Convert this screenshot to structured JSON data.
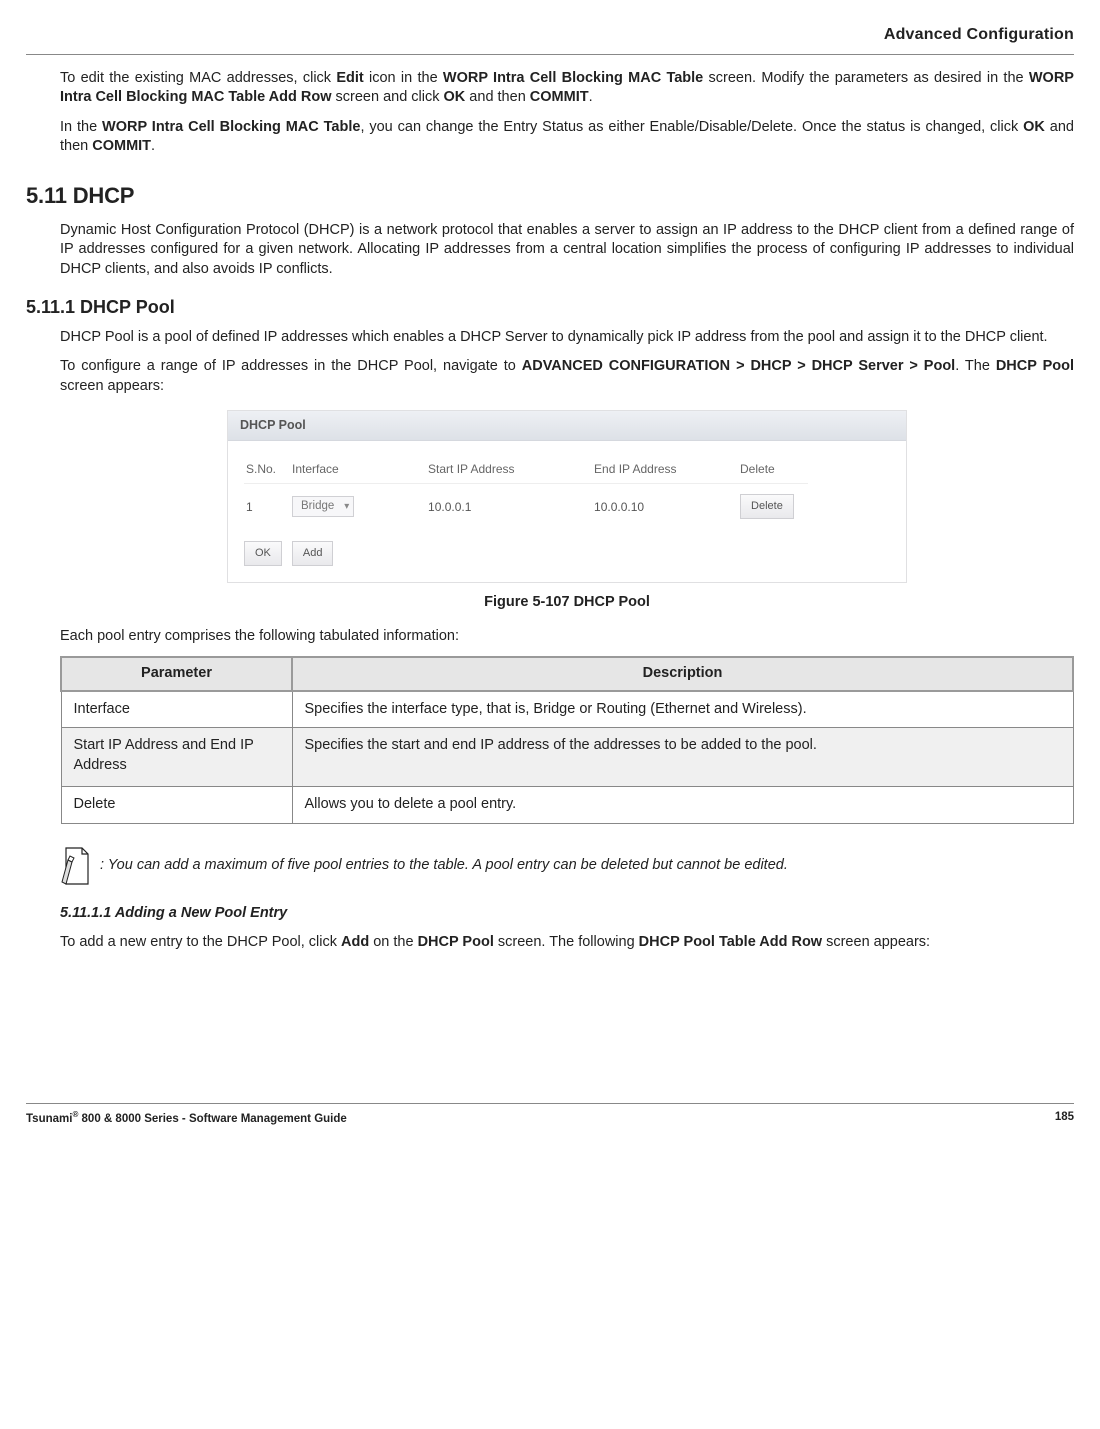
{
  "header": {
    "chapter": "Advanced Configuration"
  },
  "intro": {
    "p1_a": "To edit the existing MAC addresses, click ",
    "p1_b": "Edit",
    "p1_c": " icon in the ",
    "p1_d": "WORP Intra Cell Blocking MAC Table",
    "p1_e": " screen. Modify the parameters as desired in the ",
    "p1_f": "WORP Intra Cell Blocking MAC Table Add Row",
    "p1_g": " screen and click ",
    "p1_h": "OK",
    "p1_i": " and then ",
    "p1_j": "COMMIT",
    "p1_k": ".",
    "p2_a": "In the ",
    "p2_b": "WORP Intra Cell Blocking MAC Table",
    "p2_c": ", you can change the Entry Status as either Enable/Disable/Delete. Once the status is changed, click ",
    "p2_d": "OK",
    "p2_e": " and then ",
    "p2_f": "COMMIT",
    "p2_g": "."
  },
  "dhcp": {
    "heading": "5.11 DHCP",
    "p1": "Dynamic Host Configuration Protocol (DHCP) is a network protocol that enables a server to assign an IP address to the DHCP client from a defined range of IP addresses configured for a given network. Allocating IP addresses from a central location simplifies the process of configuring IP addresses to individual DHCP clients, and also avoids IP conflicts."
  },
  "pool": {
    "heading": "5.11.1 DHCP Pool",
    "p1": "DHCP Pool is a pool of defined IP addresses which enables a DHCP Server to dynamically pick IP address from the pool and assign it to the DHCP client.",
    "p2_a": "To configure a range of IP addresses in the DHCP Pool, navigate to ",
    "p2_b": "ADVANCED CONFIGURATION > DHCP > DHCP Server > Pool",
    "p2_c": ". The ",
    "p2_d": "DHCP Pool",
    "p2_e": " screen appears:"
  },
  "figure": {
    "panel_title": "DHCP Pool",
    "th": {
      "sno": "S.No.",
      "iface": "Interface",
      "start": "Start IP Address",
      "end": "End IP Address",
      "del": "Delete"
    },
    "row": {
      "sno": "1",
      "iface": "Bridge",
      "start": "10.0.0.1",
      "end": "10.0.0.10",
      "del_btn": "Delete"
    },
    "btn_ok": "OK",
    "btn_add": "Add",
    "caption": "Figure 5-107 DHCP Pool"
  },
  "table_lead": "Each pool entry comprises the following tabulated information:",
  "ptable": {
    "h1": "Parameter",
    "h2": "Description",
    "r1p": "Interface",
    "r1d": "Specifies the interface type, that is, Bridge or Routing (Ethernet and Wireless).",
    "r2p": "Start IP Address and End IP Address",
    "r2d": "Specifies the start and end IP address of the addresses to be added to the pool.",
    "r3p": "Delete",
    "r3d": "Allows you to delete a pool entry."
  },
  "note": ": You can add a maximum of five pool entries to the table. A pool entry can be deleted but cannot be edited.",
  "adding": {
    "heading": "5.11.1.1 Adding a New Pool Entry",
    "p_a": "To add a new entry to the DHCP Pool, click ",
    "p_b": "Add",
    "p_c": " on the ",
    "p_d": "DHCP Pool",
    "p_e": " screen. The following ",
    "p_f": "DHCP Pool Table Add Row",
    "p_g": " screen appears:"
  },
  "footer": {
    "left_a": "Tsunami",
    "left_b": "®",
    "left_c": " 800 & 8000 Series - Software Management Guide",
    "page": "185"
  }
}
